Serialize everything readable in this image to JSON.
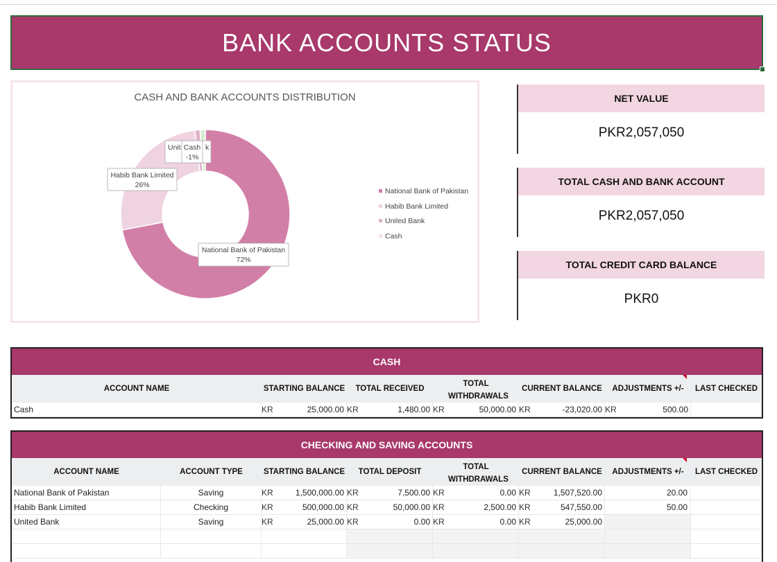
{
  "title": "BANK ACCOUNTS STATUS",
  "colors": {
    "accent": "#a8396a",
    "light": "#f2d6e2",
    "header": "#eceef0"
  },
  "chart_data": {
    "type": "pie",
    "title": "CASH AND BANK ACCOUNTS DISTRIBUTION",
    "donut": true,
    "legend_position": "right",
    "series": [
      {
        "name": "National Bank of Pakistan",
        "value": 72,
        "label": "72%",
        "color": "#d27fa8"
      },
      {
        "name": "Habib Bank Limited",
        "value": 26,
        "label": "26%",
        "color": "#efd3e0"
      },
      {
        "name": "United Bank",
        "value": 1,
        "label": "Unit   k",
        "color": "#e0b3c8"
      },
      {
        "name": "Cash",
        "value": 1,
        "label": "-1%",
        "color": "#d7ecd2"
      }
    ],
    "labels": {
      "nbp_name": "National Bank of Pakistan",
      "nbp_pct": "72%",
      "hbl_name": "Habib Bank Limited",
      "hbl_pct": "26%",
      "ub_partial_a": "Unit",
      "ub_partial_b": "k",
      "cash_name": "Cash",
      "cash_pct": "-1%"
    }
  },
  "kpis": [
    {
      "label": "NET VALUE",
      "value": "PKR2,057,050"
    },
    {
      "label": "TOTAL CASH AND BANK ACCOUNT",
      "value": "PKR2,057,050"
    },
    {
      "label": "TOTAL CREDIT CARD BALANCE",
      "value": "PKR0"
    }
  ],
  "cash_table": {
    "title": "CASH",
    "headers": [
      "ACCOUNT NAME",
      "STARTING BALANCE",
      "TOTAL RECEIVED",
      "TOTAL WITHDRAWALS",
      "CURRENT BALANCE",
      "ADJUSTMENTS +/-",
      "LAST CHECKED"
    ],
    "currency_prefix": "KR",
    "rows": [
      {
        "name": "Cash",
        "starting": "25,000.00",
        "received": "1,480.00",
        "withdrawals": "50,000.00",
        "current": "-23,020.00",
        "adjust": "500.00",
        "checked": ""
      }
    ]
  },
  "checking_table": {
    "title": "CHECKING AND SAVING ACCOUNTS",
    "headers": [
      "ACCOUNT NAME",
      "ACCOUNT TYPE",
      "STARTING BALANCE",
      "TOTAL DEPOSIT",
      "TOTAL WITHDRAWALS",
      "CURRENT BALANCE",
      "ADJUSTMENTS +/-",
      "LAST CHECKED"
    ],
    "currency_prefix": "KR",
    "rows": [
      {
        "name": "National Bank of Pakistan",
        "type": "Saving",
        "starting": "1,500,000.00",
        "deposit": "7,500.00",
        "withdrawals": "0.00",
        "current": "1,507,520.00",
        "adjust": "20.00",
        "checked": ""
      },
      {
        "name": "Habib Bank Limited",
        "type": "Checking",
        "starting": "500,000.00",
        "deposit": "50,000.00",
        "withdrawals": "2,500.00",
        "current": "547,550.00",
        "adjust": "50.00",
        "checked": ""
      },
      {
        "name": "United Bank",
        "type": "Saving",
        "starting": "25,000.00",
        "deposit": "0.00",
        "withdrawals": "0.00",
        "current": "25,000.00",
        "adjust": "",
        "checked": ""
      }
    ]
  }
}
